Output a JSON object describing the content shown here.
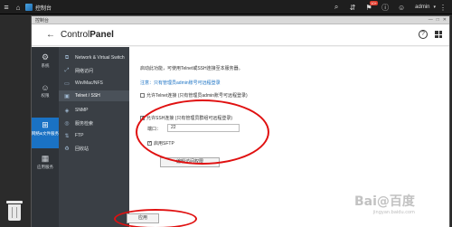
{
  "taskbar": {
    "app_title": "控制台",
    "notification_count": "10+",
    "username": "admin",
    "icons": [
      "menu-icon",
      "home-icon",
      "search-icon",
      "network-icon",
      "notification-icon",
      "info-icon",
      "user-icon",
      "more-icon"
    ]
  },
  "window": {
    "title": "控制台",
    "header": {
      "prefix": "Control",
      "suffix": "Panel"
    }
  },
  "categories": [
    {
      "label": "系统",
      "icon": "gear-icon"
    },
    {
      "label": "权限",
      "icon": "user-icon"
    },
    {
      "label": "网络&文件服务",
      "icon": "network-service-icon",
      "active": true
    },
    {
      "label": "应用服务",
      "icon": "apps-icon"
    }
  ],
  "sub_nav": [
    {
      "label": "Network & Virtual Switch",
      "icon": "network-switch-icon"
    },
    {
      "label": "网络访问",
      "icon": "network-access-icon"
    },
    {
      "label": "Win/Mac/NFS",
      "icon": "folder-share-icon"
    },
    {
      "label": "Telnet / SSH",
      "icon": "terminal-icon",
      "active": true
    },
    {
      "label": "SNMP",
      "icon": "snmp-icon"
    },
    {
      "label": "服务检索",
      "icon": "service-discovery-icon"
    },
    {
      "label": "FTP",
      "icon": "ftp-icon"
    },
    {
      "label": "回收站",
      "icon": "recycle-icon"
    }
  ],
  "content": {
    "intro": "启动此功能，可使用Telnet或SSH连接至本服务器。",
    "note": "注意：只有管理员admin账号可远程登录",
    "telnet_label": "允许Telnet连接 (只有管理员admin账号可远程登录)",
    "telnet_checked": false,
    "ssh_label": "允许SSH连接 (只有管理员群组可远程登录)",
    "ssh_checked": true,
    "port_label": "端口：",
    "port_value": "22",
    "sftp_label": "启用SFTP",
    "sftp_checked": true,
    "edit_button": "编辑访问权限",
    "apply_button": "应用"
  },
  "accent_color": "#1a72c4",
  "annotation_color": "#e01010",
  "watermark": {
    "main": "Bai@百度",
    "sub": "jingyan.baidu.com"
  }
}
